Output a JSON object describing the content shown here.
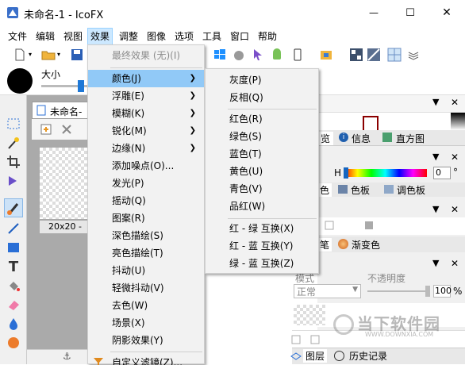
{
  "window": {
    "title": "未命名-1 - IcoFX",
    "min_glyph": "—",
    "max_glyph": "☐",
    "close_glyph": "✕"
  },
  "menubar": {
    "items": [
      "文件",
      "编辑",
      "视图",
      "效果",
      "调整",
      "图像",
      "选项",
      "工具",
      "窗口",
      "帮助"
    ]
  },
  "brush": {
    "size_label": "大小"
  },
  "document": {
    "tab_title": "未命名-",
    "canvas_size": "20x20 -"
  },
  "effects_menu": {
    "items": [
      {
        "label": "最终效果 (无)(I)",
        "disabled": true
      },
      {
        "label": "颜色(J)",
        "submenu": true
      },
      {
        "label": "浮雕(E)",
        "submenu": true
      },
      {
        "label": "模糊(K)",
        "submenu": true
      },
      {
        "label": "锐化(M)",
        "submenu": true
      },
      {
        "label": "边缘(N)",
        "submenu": true
      },
      {
        "label": "添加噪点(O)..."
      },
      {
        "label": "发光(P)"
      },
      {
        "label": "摇动(Q)"
      },
      {
        "label": "图案(R)"
      },
      {
        "label": "深色描绘(S)"
      },
      {
        "label": "亮色描绘(T)"
      },
      {
        "label": "抖动(U)"
      },
      {
        "label": "轻微抖动(V)"
      },
      {
        "label": "去色(W)"
      },
      {
        "label": "场景(X)"
      },
      {
        "label": "阴影效果(Y)"
      },
      {
        "label": "自定义滤镜(Z)..."
      }
    ]
  },
  "color_submenu": {
    "items": [
      "灰度(P)",
      "反相(Q)",
      "红色(R)",
      "绿色(S)",
      "蓝色(T)",
      "黄色(U)",
      "青色(V)",
      "品红(W)",
      "红 - 绿 互换(X)",
      "红 - 蓝 互换(Y)",
      "绿 - 蓝 互换(Z)"
    ]
  },
  "right_panels": {
    "preview_tab": "览",
    "info_tab": "信息",
    "histogram_tab": "直方图",
    "h_label": "H",
    "h_value": "0",
    "degree": "°",
    "color_tab_partial": "色",
    "palette_tab": "色板",
    "color_palette_tab": "调色板",
    "brush_tab_partial": "笔",
    "gradient_tab": "渐变色",
    "mode_label": "模式",
    "opacity_label": "不透明度",
    "mode_value": "正常",
    "opacity_value": "100",
    "percent": "%",
    "layers_tab": "图层",
    "history_tab": "历史记录"
  },
  "watermark": {
    "text": "当下软件园",
    "sub": "WWW.DOWNXIA.COM"
  },
  "colors": {
    "highlight": "#91c9f7",
    "active_menu": "#cce8ff",
    "hue_marker": "#1565c0"
  }
}
